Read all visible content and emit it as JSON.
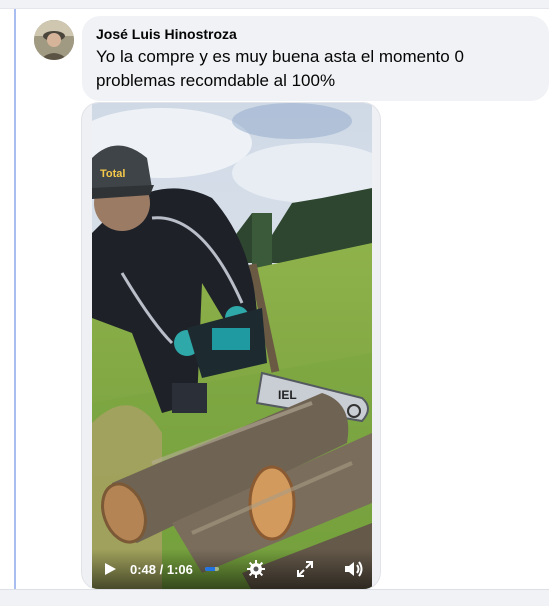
{
  "comment": {
    "author": "José Luis Hinostroza",
    "text": "Yo la compre y es muy buena asta el momento 0 problemas recomdable al 100%"
  },
  "video": {
    "time_label": "0:48 / 1:06",
    "progress_fraction": 0.727,
    "cap_brand_text": "Total",
    "chainsaw_bar_text": "IEL"
  },
  "colors": {
    "bubble": "#f0f2f5",
    "thread_line": "#a9bdf0",
    "progress": "#2374e1"
  },
  "icons": {
    "play": "play-icon",
    "settings": "gear-icon",
    "fullscreen": "fullscreen-icon",
    "volume": "volume-icon"
  }
}
